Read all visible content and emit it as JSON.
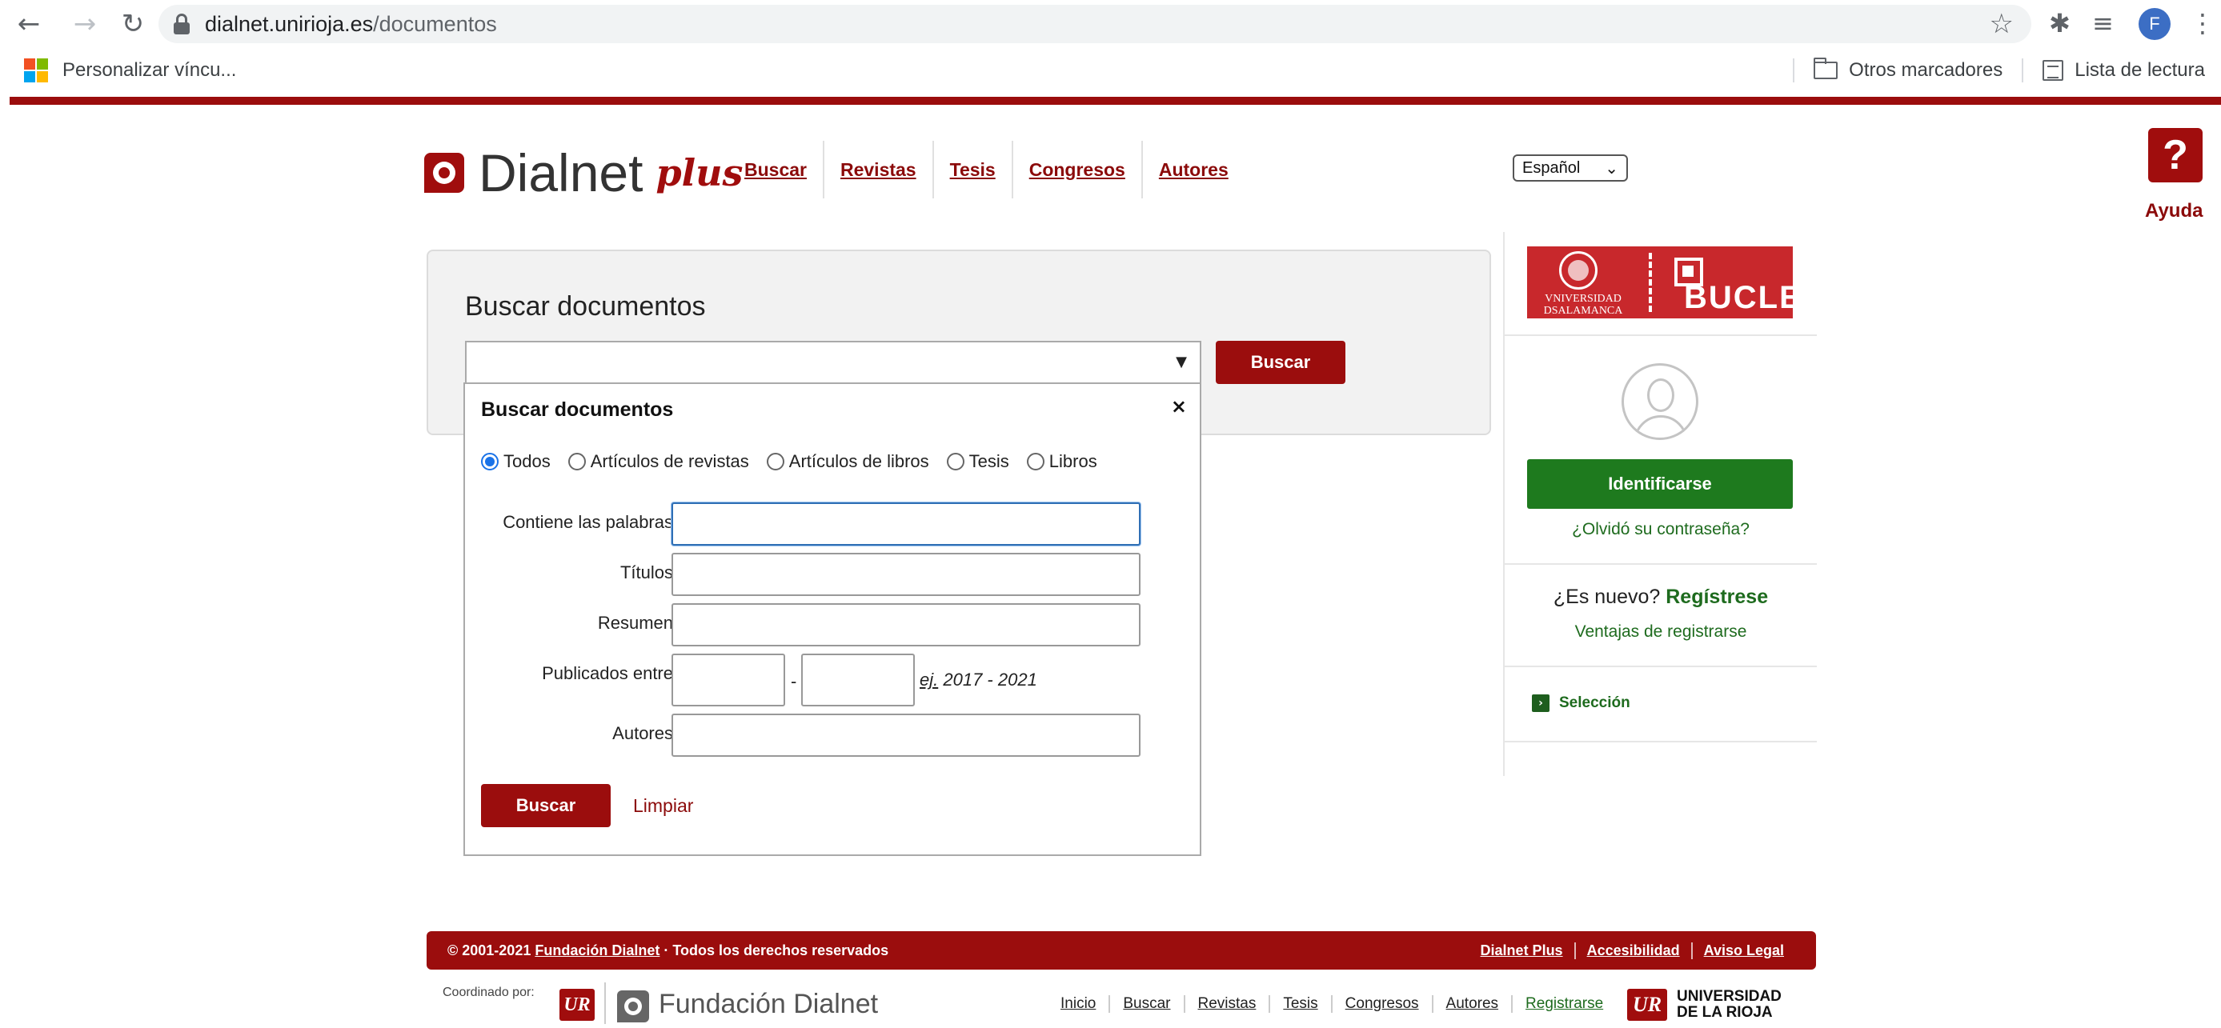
{
  "browser": {
    "url_host": "dialnet.unirioja.es",
    "url_path": "/documentos",
    "profile_initial": "F",
    "bookmarks": {
      "left": "Personalizar víncu...",
      "other": "Otros marcadores",
      "reading": "Lista de lectura"
    }
  },
  "header": {
    "logo_text": "Dialnet",
    "logo_plus": "plus",
    "nav": [
      {
        "label": "Buscar"
      },
      {
        "label": "Revistas"
      },
      {
        "label": "Tesis"
      },
      {
        "label": "Congresos"
      },
      {
        "label": "Autores"
      }
    ],
    "language": "Español",
    "help_symbol": "?",
    "help_label": "Ayuda"
  },
  "search": {
    "title": "Buscar documentos",
    "button": "Buscar"
  },
  "advanced": {
    "title": "Buscar documentos",
    "close": "×",
    "types": [
      {
        "label": "Todos",
        "checked": true
      },
      {
        "label": "Artículos de revistas",
        "checked": false
      },
      {
        "label": "Artículos de libros",
        "checked": false
      },
      {
        "label": "Tesis",
        "checked": false
      },
      {
        "label": "Libros",
        "checked": false
      }
    ],
    "fields": {
      "words": "Contiene las palabras",
      "titles": "Títulos",
      "summary": "Resumen",
      "published": "Publicados entre",
      "authors": "Autores"
    },
    "year_dash": "-",
    "year_example_prefix": "ej.",
    "year_example": "2017 - 2021",
    "search_button": "Buscar",
    "clear_link": "Limpiar"
  },
  "sidebar": {
    "usal_line1": "VNIVERSIDAD",
    "usal_line2": "DSALAMANCA",
    "bucle": "BUCLE",
    "login_button": "Identificarse",
    "forgot": "¿Olvidó su contraseña?",
    "new_user_question": "¿Es nuevo?",
    "register": "Regístrese",
    "benefits": "Ventajas de registrarse",
    "selection": "Selección"
  },
  "footer": {
    "copyright_prefix": "© 2001-2021",
    "fundacion": "Fundación Dialnet",
    "rights": "· Todos los derechos reservados",
    "links": [
      "Dialnet Plus",
      "Accesibilidad",
      "Aviso Legal"
    ],
    "coordinated_by": "Coordinado por:",
    "ur_mark": "UR",
    "fundacion_logo": "Fundación Dialnet",
    "nav": [
      "Inicio",
      "Buscar",
      "Revistas",
      "Tesis",
      "Congresos",
      "Autores",
      "Registrarse"
    ],
    "ur_line1": "UNIVERSIDAD",
    "ur_line2": "DE LA RIOJA"
  },
  "colors": {
    "brand_red": "#9b0d0d",
    "brand_green": "#1e7a1e",
    "radio_blue": "#1a73e8"
  }
}
